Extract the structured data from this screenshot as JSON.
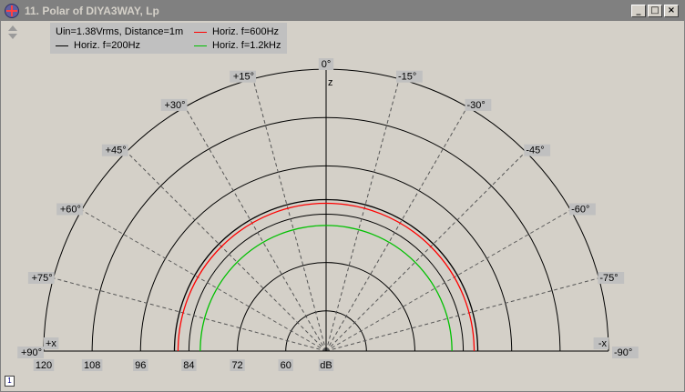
{
  "window": {
    "title": "11. Polar of DIYA3WAY, Lp",
    "buttons": {
      "minimize": "_",
      "maximize": "□",
      "close": "×"
    }
  },
  "legend": {
    "header": "Uin=1.38Vrms, Distance=1m",
    "items": [
      {
        "label": "Horiz. f=200Hz",
        "color": "#000000"
      },
      {
        "label": "Horiz. f=600Hz",
        "color": "#ff0000"
      },
      {
        "label": "Horiz. f=1.2kHz",
        "color": "#00c000"
      }
    ]
  },
  "chart_data": {
    "type": "polar",
    "angle_labels": [
      {
        "angle": 0,
        "label": "0°"
      },
      {
        "angle": -15,
        "label": "+15°"
      },
      {
        "angle": -30,
        "label": "+30°"
      },
      {
        "angle": -45,
        "label": "+45°"
      },
      {
        "angle": -60,
        "label": "+60°"
      },
      {
        "angle": -75,
        "label": "+75°"
      },
      {
        "angle": -90,
        "label": "+90°"
      },
      {
        "angle": 15,
        "label": "-15°"
      },
      {
        "angle": 30,
        "label": "-30°"
      },
      {
        "angle": 45,
        "label": "-45°"
      },
      {
        "angle": 60,
        "label": "-60°"
      },
      {
        "angle": 75,
        "label": "-75°"
      },
      {
        "angle": 90,
        "label": "-90°"
      }
    ],
    "axis_labels": {
      "top": "z",
      "left": "+x",
      "right": "-x",
      "unit": "dB"
    },
    "radial_ticks": [
      120,
      108,
      96,
      84,
      72,
      60
    ],
    "r_range_db": [
      50,
      120
    ],
    "series": [
      {
        "name": "Horiz. f=200Hz",
        "color": "#000000",
        "values_db": 87.6
      },
      {
        "name": "Horiz. f=600Hz",
        "color": "#ff0000",
        "values_db": 86.7
      },
      {
        "name": "Horiz. f=1.2kHz",
        "color": "#00c000",
        "values_db": 81.2
      }
    ]
  }
}
